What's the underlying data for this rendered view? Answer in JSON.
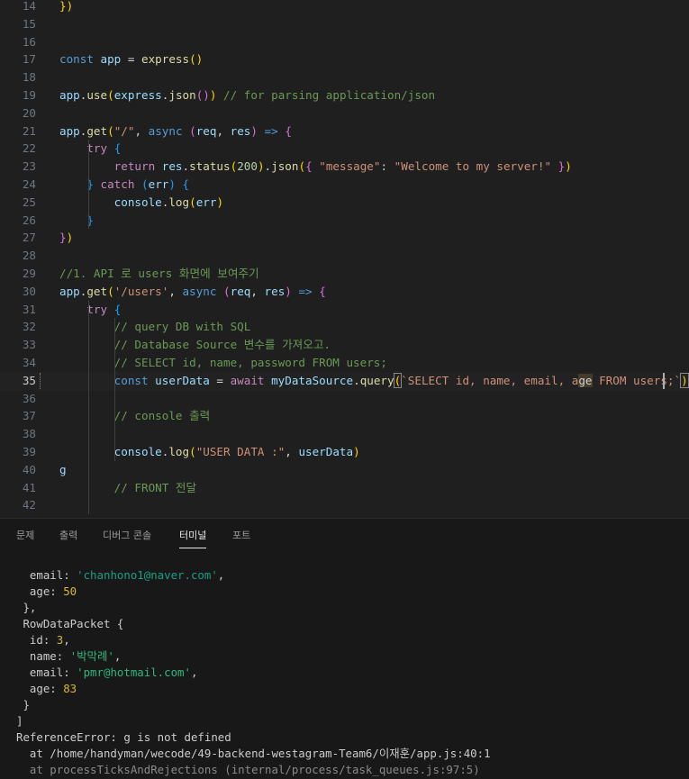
{
  "editor": {
    "lines": [
      {
        "n": "14",
        "tokens": [
          [
            "br1",
            "})"
          ]
        ]
      },
      {
        "n": "15",
        "tokens": []
      },
      {
        "n": "16",
        "tokens": []
      },
      {
        "n": "17",
        "tokens": [
          [
            "kw",
            "const "
          ],
          [
            "var",
            "app"
          ],
          [
            "def",
            " = "
          ],
          [
            "fn",
            "express"
          ],
          [
            "br1",
            "()"
          ]
        ]
      },
      {
        "n": "18",
        "tokens": []
      },
      {
        "n": "19",
        "tokens": [
          [
            "var",
            "app"
          ],
          [
            "def",
            "."
          ],
          [
            "fn",
            "use"
          ],
          [
            "br1",
            "("
          ],
          [
            "var",
            "express"
          ],
          [
            "def",
            "."
          ],
          [
            "fn",
            "json"
          ],
          [
            "br2",
            "()"
          ],
          [
            "br1",
            ")"
          ],
          [
            "cmt",
            " // for parsing application/json"
          ]
        ]
      },
      {
        "n": "20",
        "tokens": []
      },
      {
        "n": "21",
        "tokens": [
          [
            "var",
            "app"
          ],
          [
            "def",
            "."
          ],
          [
            "fn",
            "get"
          ],
          [
            "br1",
            "("
          ],
          [
            "str",
            "\"/\""
          ],
          [
            "def",
            ", "
          ],
          [
            "kw",
            "async "
          ],
          [
            "br2",
            "("
          ],
          [
            "var",
            "req"
          ],
          [
            "def",
            ", "
          ],
          [
            "var",
            "res"
          ],
          [
            "br2",
            ")"
          ],
          [
            "kw",
            " => "
          ],
          [
            "br2",
            "{"
          ]
        ]
      },
      {
        "n": "22",
        "tokens": [
          [
            "def",
            "    "
          ],
          [
            "ctrl",
            "try "
          ],
          [
            "br3",
            "{"
          ]
        ]
      },
      {
        "n": "23",
        "tokens": [
          [
            "def",
            "        "
          ],
          [
            "ctrl",
            "return "
          ],
          [
            "var",
            "res"
          ],
          [
            "def",
            "."
          ],
          [
            "fn",
            "status"
          ],
          [
            "br1",
            "("
          ],
          [
            "num",
            "200"
          ],
          [
            "br1",
            ")"
          ],
          [
            "def",
            "."
          ],
          [
            "fn",
            "json"
          ],
          [
            "br1",
            "("
          ],
          [
            "br2",
            "{ "
          ],
          [
            "str",
            "\"message\""
          ],
          [
            "def",
            ": "
          ],
          [
            "str",
            "\"Welcome to my server!\""
          ],
          [
            "br2",
            " }"
          ],
          [
            "br1",
            ")"
          ]
        ]
      },
      {
        "n": "24",
        "tokens": [
          [
            "def",
            "    "
          ],
          [
            "br3",
            "}"
          ],
          [
            "ctrl",
            " catch "
          ],
          [
            "br3",
            "("
          ],
          [
            "var",
            "err"
          ],
          [
            "br3",
            ")"
          ],
          [
            "br3",
            " {"
          ]
        ]
      },
      {
        "n": "25",
        "tokens": [
          [
            "def",
            "        "
          ],
          [
            "var",
            "console"
          ],
          [
            "def",
            "."
          ],
          [
            "fn",
            "log"
          ],
          [
            "br1",
            "("
          ],
          [
            "var",
            "err"
          ],
          [
            "br1",
            ")"
          ]
        ]
      },
      {
        "n": "26",
        "tokens": [
          [
            "def",
            "    "
          ],
          [
            "br3",
            "}"
          ]
        ]
      },
      {
        "n": "27",
        "tokens": [
          [
            "br2",
            "}"
          ],
          [
            "br1",
            ")"
          ]
        ]
      },
      {
        "n": "28",
        "tokens": []
      },
      {
        "n": "29",
        "tokens": [
          [
            "cmt",
            "//1. API 로 users 화면에 보여주기"
          ]
        ]
      },
      {
        "n": "30",
        "tokens": [
          [
            "var",
            "app"
          ],
          [
            "def",
            "."
          ],
          [
            "fn",
            "get"
          ],
          [
            "br1",
            "("
          ],
          [
            "str",
            "'/users'"
          ],
          [
            "def",
            ", "
          ],
          [
            "kw",
            "async "
          ],
          [
            "br2",
            "("
          ],
          [
            "var",
            "req"
          ],
          [
            "def",
            ", "
          ],
          [
            "var",
            "res"
          ],
          [
            "br2",
            ")"
          ],
          [
            "kw",
            " => "
          ],
          [
            "br2",
            "{"
          ]
        ]
      },
      {
        "n": "31",
        "tokens": [
          [
            "def",
            "    "
          ],
          [
            "ctrl",
            "try "
          ],
          [
            "br3",
            "{"
          ]
        ]
      },
      {
        "n": "32",
        "tokens": [
          [
            "def",
            "        "
          ],
          [
            "cmt",
            "// query DB with SQL"
          ]
        ]
      },
      {
        "n": "33",
        "tokens": [
          [
            "def",
            "        "
          ],
          [
            "cmt",
            "// Database Source 변수를 가져오고."
          ]
        ]
      },
      {
        "n": "34",
        "tokens": [
          [
            "def",
            "        "
          ],
          [
            "cmt",
            "// SELECT id, name, password FROM users;"
          ]
        ]
      },
      {
        "n": "35",
        "tokens": [
          [
            "def",
            "        "
          ],
          [
            "kw",
            "const "
          ],
          [
            "var",
            "userData"
          ],
          [
            "def",
            " = "
          ],
          [
            "ctrl",
            "await "
          ],
          [
            "var",
            "myDataSource"
          ],
          [
            "def",
            "."
          ],
          [
            "fn",
            "query"
          ],
          [
            "brk",
            "("
          ],
          [
            "str",
            "`SELECT id, name, email, a"
          ],
          [
            "warn",
            "ge"
          ],
          [
            "str",
            " FROM users;`"
          ],
          [
            "brk",
            ")"
          ]
        ]
      },
      {
        "n": "36",
        "tokens": []
      },
      {
        "n": "37",
        "tokens": [
          [
            "def",
            "        "
          ],
          [
            "cmt",
            "// console 출력"
          ]
        ]
      },
      {
        "n": "38",
        "tokens": []
      },
      {
        "n": "39",
        "tokens": [
          [
            "def",
            "        "
          ],
          [
            "var",
            "console"
          ],
          [
            "def",
            "."
          ],
          [
            "fn",
            "log"
          ],
          [
            "br1",
            "("
          ],
          [
            "str",
            "\"USER DATA :\""
          ],
          [
            "def",
            ", "
          ],
          [
            "var",
            "userData"
          ],
          [
            "br1",
            ")"
          ]
        ]
      },
      {
        "n": "40",
        "tokens": [
          [
            "var",
            "g"
          ]
        ]
      },
      {
        "n": "41",
        "tokens": [
          [
            "def",
            "        "
          ],
          [
            "cmt",
            "// FRONT 전달"
          ]
        ]
      },
      {
        "n": "42",
        "tokens": []
      }
    ]
  },
  "panel": {
    "tabs": [
      "문제",
      "출력",
      "디버그 콘솔",
      "터미널",
      "포트"
    ],
    "active_tab": "터미널"
  },
  "terminal": {
    "lines": [
      [
        [
          "key",
          "  email: "
        ],
        [
          "str",
          "'chanhono1@naver.com'"
        ],
        [
          "key",
          ","
        ]
      ],
      [
        [
          "key",
          "  age: "
        ],
        [
          "num",
          "50"
        ]
      ],
      [
        [
          "key",
          " },"
        ]
      ],
      [
        [
          "key",
          " RowDataPacket {"
        ]
      ],
      [
        [
          "key",
          "  id: "
        ],
        [
          "num",
          "3"
        ],
        [
          "key",
          ","
        ]
      ],
      [
        [
          "key",
          "  name: "
        ],
        [
          "strg",
          "'박막례'"
        ],
        [
          "key",
          ","
        ]
      ],
      [
        [
          "key",
          "  email: "
        ],
        [
          "strg",
          "'pmr@hotmail.com'"
        ],
        [
          "key",
          ","
        ]
      ],
      [
        [
          "key",
          "  age: "
        ],
        [
          "num",
          "83"
        ]
      ],
      [
        [
          "key",
          " }"
        ]
      ],
      [
        [
          "key",
          "]"
        ]
      ],
      [
        [
          "key",
          "ReferenceError: g is not defined"
        ]
      ],
      [
        [
          "key",
          "  at /home/handyman/wecode/49-backend-westagram-Team6/이재훈/app.js:40:1"
        ]
      ],
      [
        [
          "dim",
          "  at processTicksAndRejections (internal/process/task_queues.js:97:5)"
        ]
      ]
    ]
  }
}
